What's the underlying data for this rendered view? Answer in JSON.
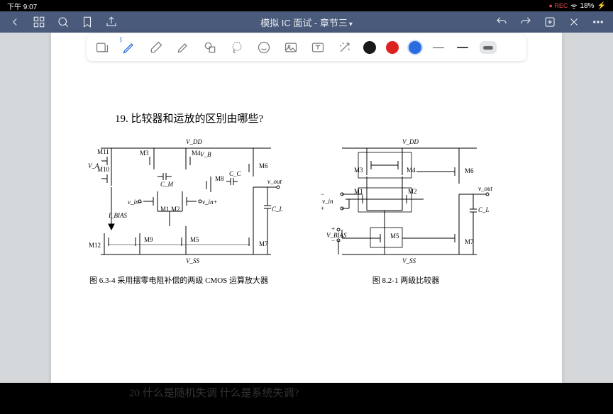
{
  "status": {
    "time": "下午 9:07",
    "rec": "● REC",
    "wifi": "􀙇",
    "battery": "18%"
  },
  "header": {
    "title": "模拟 IC 面试 - 章节三"
  },
  "document": {
    "q19": "19. 比较器和运放的区别由哪些?",
    "fig_left_caption": "图 6.3-4  采用摆零电阻补偿的两级 CMOS 运算放大器",
    "fig_right_caption": "图 8.2-1  两级比较器",
    "q20": "20  什么是随机失调   什么是系统失调?"
  },
  "circuit_left": {
    "vdd": "V_DD",
    "vss": "V_SS",
    "m11": "M11",
    "m10": "M10",
    "m3": "M3",
    "m4": "M4",
    "vb": "V_B",
    "m6": "M6",
    "va": "V_A",
    "cm": "C_M",
    "m8": "M8",
    "cc": "C_C",
    "vout": "v_out",
    "vin_n": "v_in−",
    "vin_p": "v_in+",
    "m1": "M1",
    "m2": "M2",
    "cl": "C_L",
    "ibias": "I_BIAS",
    "m12": "M12",
    "m9": "M9",
    "m5": "M5",
    "m7": "M7"
  },
  "circuit_right": {
    "vdd": "V_DD",
    "m3": "M3",
    "m4": "M4",
    "m6": "M6",
    "m1": "M1",
    "m2": "M2",
    "vout": "v_out",
    "cl": "C_L",
    "vin": "v_in",
    "minus": "−",
    "plus": "+",
    "vbias_p": "+",
    "vbias_m": "−",
    "vbias": "V_BIAS",
    "m5": "M5",
    "m7": "M7",
    "vss": "V_SS"
  }
}
